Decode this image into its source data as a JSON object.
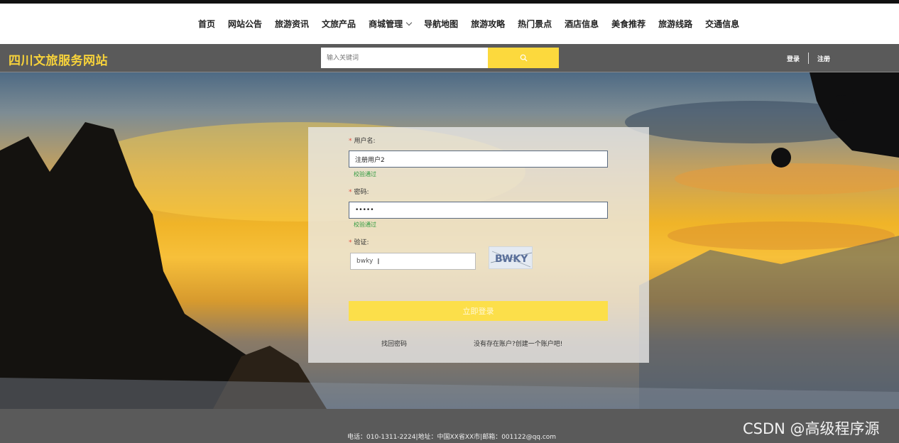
{
  "nav": {
    "items": [
      "首页",
      "网站公告",
      "旅游资讯",
      "文旅产品",
      "商城管理",
      "导航地图",
      "旅游攻略",
      "热门景点",
      "酒店信息",
      "美食推荐",
      "旅游线路",
      "交通信息"
    ]
  },
  "header": {
    "site_title": "四川文旅服务网站",
    "search_placeholder": "输入关键词",
    "login_link": "登录",
    "register_link": "注册"
  },
  "form": {
    "username_label": "用户名:",
    "username_value": "注册用户2",
    "username_valid": "校验通过",
    "password_label": "密码:",
    "password_value": "•••••",
    "password_valid": "校验通过",
    "captcha_label": "验证:",
    "captcha_value": "bwky",
    "captcha_image_text": "BWKY",
    "submit_label": "立即登录",
    "forgot_link": "找回密码",
    "create_link": "没有存在账户?创建一个账户吧!"
  },
  "footer": {
    "contact": "电话：010-1311-2224|地址：中国XX省XX市|邮箱：001122@qq.com",
    "watermark": "CSDN @高级程序源"
  },
  "colors": {
    "accent": "#fcd93d",
    "title": "#f7d23a",
    "bar": "#5a5a5a",
    "valid": "#2e9a3e"
  }
}
